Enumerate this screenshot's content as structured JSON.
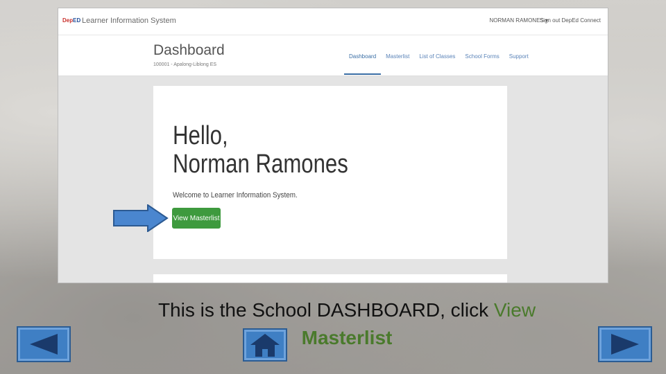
{
  "screenshot": {
    "logo": {
      "dep": "Dep",
      "ed": "ED"
    },
    "app_title": "Learner Information System",
    "user": "NORMAN RAMONES ▾",
    "signout": "Sign out DepEd Connect",
    "page_title": "Dashboard",
    "school": "100001 - Apalong-Liblong ES",
    "nav": [
      "Dashboard",
      "Masterlist",
      "List of Classes",
      "School Forms",
      "Support"
    ],
    "hello_line1": "Hello,",
    "hello_line2": "Norman Ramones",
    "welcome": "Welcome to Learner Information System.",
    "view_masterlist_button": "View Masterlist"
  },
  "caption": {
    "text": "This is the School DASHBOARD, click ",
    "highlight_line1": "View",
    "highlight_line2": "Masterlist"
  },
  "colors": {
    "highlight": "#4a7a2c",
    "button_green": "#3e9a3e",
    "nav_blue": "#3f7fc4"
  },
  "icons": {
    "prev": "left-triangle-icon",
    "next": "right-triangle-icon",
    "home": "house-icon",
    "pointer": "right-arrow-icon"
  }
}
